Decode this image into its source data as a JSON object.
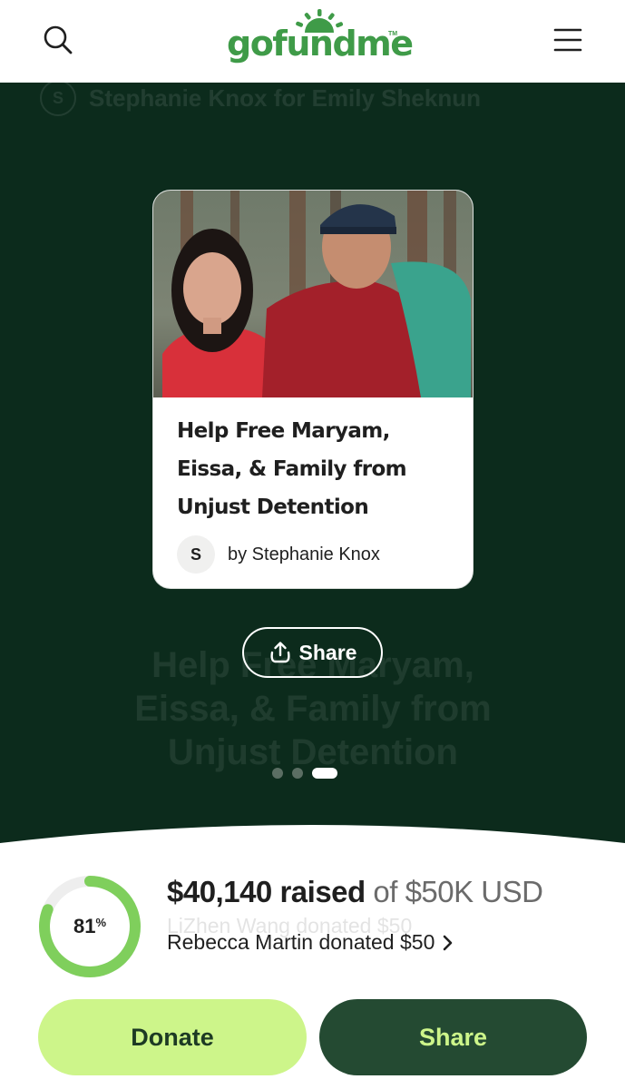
{
  "header": {
    "logo_text": "gofundme",
    "logo_tm": "TM",
    "icons": {
      "search": "search-icon",
      "menu": "hamburger-menu-icon"
    }
  },
  "hero": {
    "ghost_author_initial": "S",
    "ghost_author": "Stephanie Knox for Emily Sheknun",
    "ghost_title": "Help Free Maryam, Eissa, & Family from Unjust Detention",
    "card": {
      "title": "Help Free Maryam, Eissa, & Family from Unjust Detention",
      "avatar_initial": "S",
      "author": "by Stephanie Knox"
    },
    "share_label": "Share",
    "share_icon": "upload-share-icon",
    "carousel": {
      "count": 3,
      "active_index": 2
    }
  },
  "summary": {
    "percent": "81",
    "percent_symbol": "%",
    "progress_fraction": 0.81,
    "raised_amount": "$40,140",
    "raised_word": "raised",
    "goal_text": "of $50K USD",
    "ghost_donation": "LiZhen Wang donated $50",
    "recent_donation": "Rebecca Martin donated $50",
    "recent_donation_icon": "chevron-right-icon"
  },
  "actions": {
    "donate_label": "Donate",
    "share_label": "Share"
  },
  "colors": {
    "brand_green": "#3f9b48",
    "hero_background": "#0c2b1c",
    "donate_button": "#cdf58a",
    "share_button": "#244a32",
    "progress_fill": "#7fcf5c",
    "progress_track": "#eeeeee"
  }
}
